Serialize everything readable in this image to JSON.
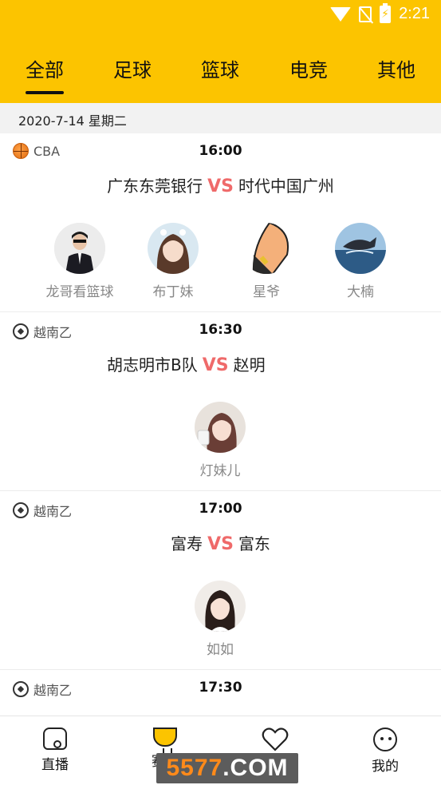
{
  "status_bar": {
    "time": "2:21"
  },
  "tabs": [
    {
      "label": "全部",
      "active": true
    },
    {
      "label": "足球",
      "active": false
    },
    {
      "label": "篮球",
      "active": false
    },
    {
      "label": "电竞",
      "active": false
    },
    {
      "label": "其他",
      "active": false
    }
  ],
  "date": "2020-7-14 星期二",
  "vs_label": "VS",
  "matches": [
    {
      "league": "CBA",
      "league_icon": "basketball-icon",
      "time": "16:00",
      "home": "广东东莞银行",
      "away": "时代中国广州",
      "anchors": [
        "龙哥看篮球",
        "布丁妹",
        "星爷",
        "大楠"
      ]
    },
    {
      "league": "越南乙",
      "league_icon": "soccer-ball-icon",
      "time": "16:30",
      "home": "胡志明市B队",
      "away": "赵明",
      "anchors": [
        "灯妹儿"
      ]
    },
    {
      "league": "越南乙",
      "league_icon": "soccer-ball-icon",
      "time": "17:00",
      "home": "富寿",
      "away": "富东",
      "anchors": [
        "如如"
      ]
    },
    {
      "league": "越南乙",
      "league_icon": "soccer-ball-icon",
      "time": "17:30"
    }
  ],
  "bottom_nav": [
    {
      "label": "直播",
      "icon": "home-live-icon"
    },
    {
      "label": "赛程",
      "icon": "trophy-icon"
    },
    {
      "label": "关注",
      "icon": "heart-icon"
    },
    {
      "label": "我的",
      "icon": "profile-face-icon"
    }
  ],
  "watermark": {
    "text_orange": "5577",
    "text_white": ".COM"
  },
  "colors": {
    "header": "#fcc400",
    "vs": "#ef6a6a",
    "date_bar": "#f2f2f2"
  }
}
